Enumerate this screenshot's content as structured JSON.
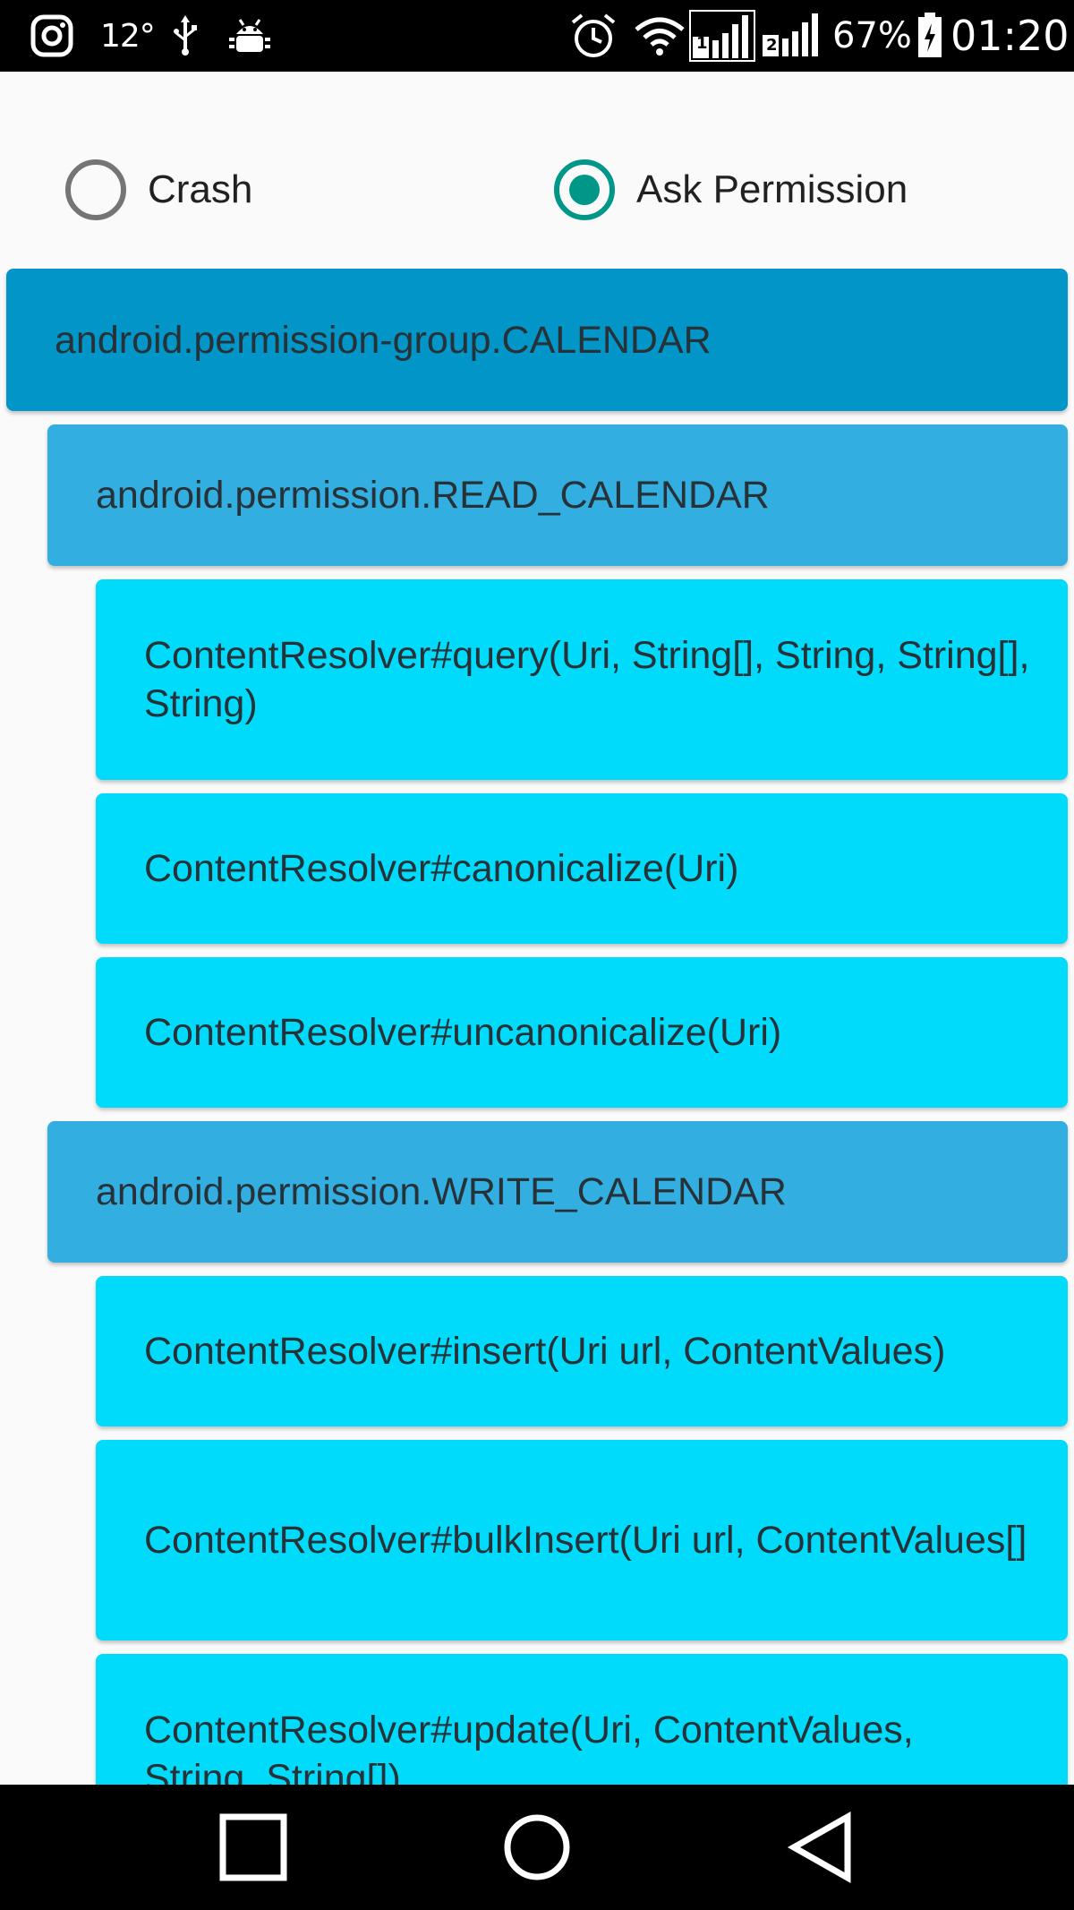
{
  "status_bar": {
    "icons": [
      "instagram-icon",
      "usb-icon",
      "android-debug-icon",
      "alarm-icon",
      "wifi-icon",
      "signal-sim1-icon",
      "signal-sim2-icon",
      "battery-charging-icon"
    ],
    "temperature": "12°",
    "sim1_label": "1",
    "sim2_label": "2",
    "battery_percent": "67%",
    "time": "01:20"
  },
  "options": {
    "crash_label": "Crash",
    "crash_checked": false,
    "ask_label": "Ask Permission",
    "ask_checked": true,
    "accent_color": "#009688"
  },
  "tree": {
    "group": "android.permission-group.CALENDAR",
    "read_permission": "android.permission.READ_CALENDAR",
    "read_methods": [
      "ContentResolver#query(Uri, String[], String, String[], String)",
      "ContentResolver#canonicalize(Uri)",
      "ContentResolver#uncanonicalize(Uri)"
    ],
    "write_permission": "android.permission.WRITE_CALENDAR",
    "write_methods": [
      "ContentResolver#insert(Uri url, ContentValues)",
      "ContentResolver#bulkInsert(Uri url, ContentValues[]",
      "ContentResolver#update(Uri, ContentValues, String, String[])"
    ],
    "colors": {
      "group": "#0296c8",
      "permission": "#33aee0",
      "method": "#00dbfb"
    }
  },
  "nav_bar": {
    "icons": [
      "recents-square-icon",
      "home-circle-icon",
      "back-triangle-icon"
    ]
  }
}
